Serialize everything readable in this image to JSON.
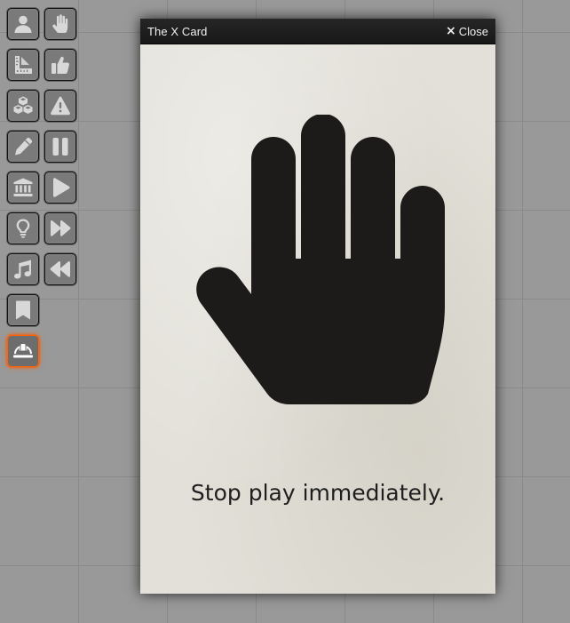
{
  "toolbar": {
    "rows": [
      [
        {
          "icon": "user-icon"
        },
        {
          "icon": "hand-icon"
        }
      ],
      [
        {
          "icon": "ruler-icon"
        },
        {
          "icon": "thumbs-up-icon"
        }
      ],
      [
        {
          "icon": "cubes-icon"
        },
        {
          "icon": "warning-icon"
        }
      ],
      [
        {
          "icon": "pencil-icon"
        },
        {
          "icon": "pause-icon"
        }
      ],
      [
        {
          "icon": "landmark-icon"
        },
        {
          "icon": "play-icon"
        }
      ],
      [
        {
          "icon": "lightbulb-icon"
        },
        {
          "icon": "fast-forward-icon"
        }
      ],
      [
        {
          "icon": "music-icon"
        },
        {
          "icon": "rewind-icon"
        }
      ],
      [
        {
          "icon": "bookmark-icon"
        }
      ],
      [
        {
          "icon": "hard-hat-icon",
          "active": true
        }
      ]
    ],
    "active_color": "#ff6400"
  },
  "window": {
    "title": "The X Card",
    "close_label": "Close",
    "close_icon": "×",
    "message": "Stop play immediately.",
    "illustration": "hand-icon"
  }
}
